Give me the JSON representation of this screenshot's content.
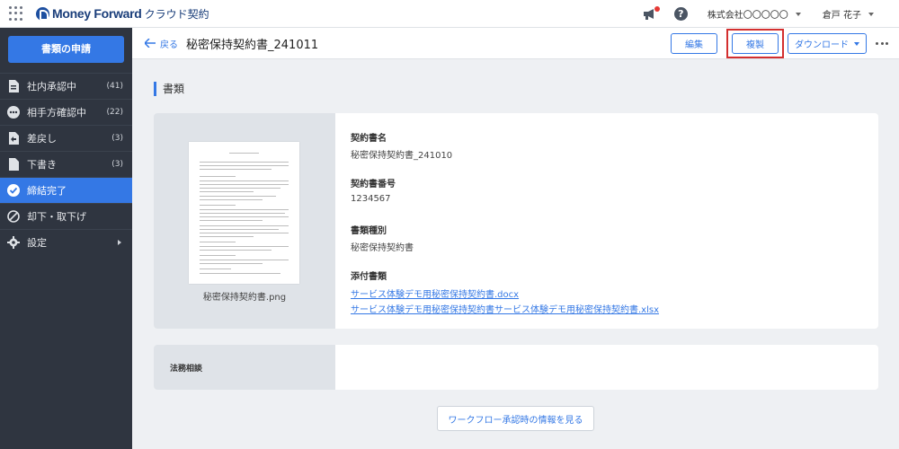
{
  "topbar": {
    "brand": "Money Forward",
    "product": "クラウド契約",
    "tenant": "株式会社〇〇〇〇〇",
    "user": "倉戸 花子",
    "icons": [
      "apps-grid-icon",
      "megaphone-icon",
      "help-icon"
    ],
    "notification_color": "#e53935"
  },
  "sidebar": {
    "apply_label": "書類の申請",
    "items": [
      {
        "label": "社内承認中",
        "count": "(41)",
        "icon": "document-icon"
      },
      {
        "label": "相手方確認中",
        "count": "(22)",
        "icon": "ellipsis-circle-icon"
      },
      {
        "label": "差戻し",
        "count": "(3)",
        "icon": "return-document-icon"
      },
      {
        "label": "下書き",
        "count": "(3)",
        "icon": "draft-document-icon"
      },
      {
        "label": "締結完了",
        "count": "",
        "icon": "check-circle-icon"
      },
      {
        "label": "却下・取下げ",
        "count": "",
        "icon": "prohibited-icon"
      },
      {
        "label": "設定",
        "count": "",
        "icon": "gear-icon"
      }
    ],
    "active_item": "締結完了"
  },
  "subheader": {
    "back_label": "戻る",
    "title": "秘密保持契約書_241011",
    "edit_label": "編集",
    "copy_label": "複製",
    "download_label": "ダウンロード"
  },
  "section": {
    "title": "書類"
  },
  "document": {
    "thumbnail_caption": "秘密保持契約書.png",
    "contract_name_label": "契約書名",
    "contract_name": "秘密保持契約書_241010",
    "contract_number_label": "契約書番号",
    "contract_number": "1234567",
    "doc_type_label": "書類種別",
    "doc_type": "秘密保持契約書",
    "attachments_label": "添付書類",
    "attachments": [
      "サービス体験デモ用秘密保持契約書.docx",
      "サービス体験デモ用秘密保持契約書サービス体験デモ用秘密保持契約書.xlsx"
    ]
  },
  "legal": {
    "label": "法務相談"
  },
  "workflow_button": "ワークフロー承認時の情報を見る",
  "colors": {
    "accent": "#3478e5",
    "sidebar": "#2f3540",
    "highlight": "#d32f2f"
  }
}
